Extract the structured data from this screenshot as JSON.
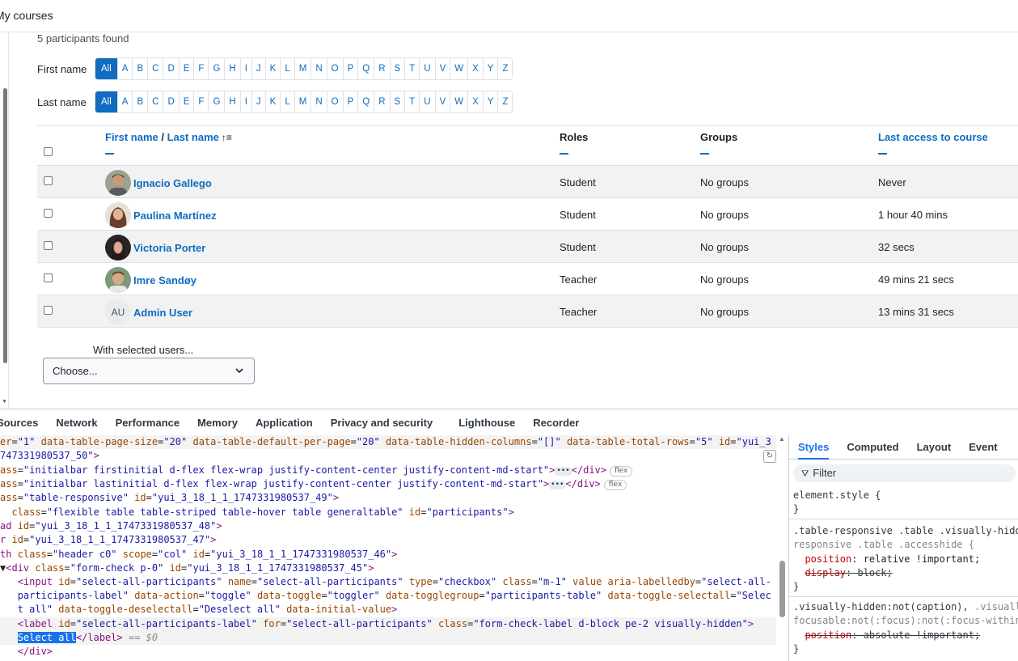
{
  "header": {
    "my_courses": "My courses"
  },
  "participants_found": "5 participants found",
  "initialbars": {
    "first_name_label": "First name",
    "last_name_label": "Last name",
    "letters": [
      "All",
      "A",
      "B",
      "C",
      "D",
      "E",
      "F",
      "G",
      "H",
      "I",
      "J",
      "K",
      "L",
      "M",
      "N",
      "O",
      "P",
      "Q",
      "R",
      "S",
      "T",
      "U",
      "V",
      "W",
      "X",
      "Y",
      "Z"
    ]
  },
  "table": {
    "headers": {
      "first_name": "First name",
      "separator": " / ",
      "last_name": "Last name",
      "sort_icon": "↑≡",
      "roles": "Roles",
      "groups": "Groups",
      "last_access": "Last access to course"
    },
    "rows": [
      {
        "name": "Ignacio Gallego",
        "role": "Student",
        "groups": "No groups",
        "last_access": "Never",
        "avatar": "photo"
      },
      {
        "name": "Paulina Martínez",
        "role": "Student",
        "groups": "No groups",
        "last_access": "1 hour 40 mins",
        "avatar": "photo"
      },
      {
        "name": "Victoria Porter",
        "role": "Student",
        "groups": "No groups",
        "last_access": "32 secs",
        "avatar": "photo"
      },
      {
        "name": "Imre Sandøy",
        "role": "Teacher",
        "groups": "No groups",
        "last_access": "49 mins 21 secs",
        "avatar": "photo"
      },
      {
        "name": "Admin User",
        "role": "Teacher",
        "groups": "No groups",
        "last_access": "13 mins 31 secs",
        "avatar": "AU"
      }
    ]
  },
  "bulk": {
    "label": "With selected users...",
    "select_value": "Choose..."
  },
  "devtools": {
    "tabs": [
      "Sources",
      "Network",
      "Performance",
      "Memory",
      "Application",
      "Privacy and security",
      "Lighthouse",
      "Recorder"
    ],
    "styles_tabs": [
      "Styles",
      "Computed",
      "Layout",
      "Event List"
    ],
    "filter_placeholder": "Filter",
    "flex_badge": "flex",
    "dollar_zero": "== $0",
    "selected_text": "Select all"
  }
}
